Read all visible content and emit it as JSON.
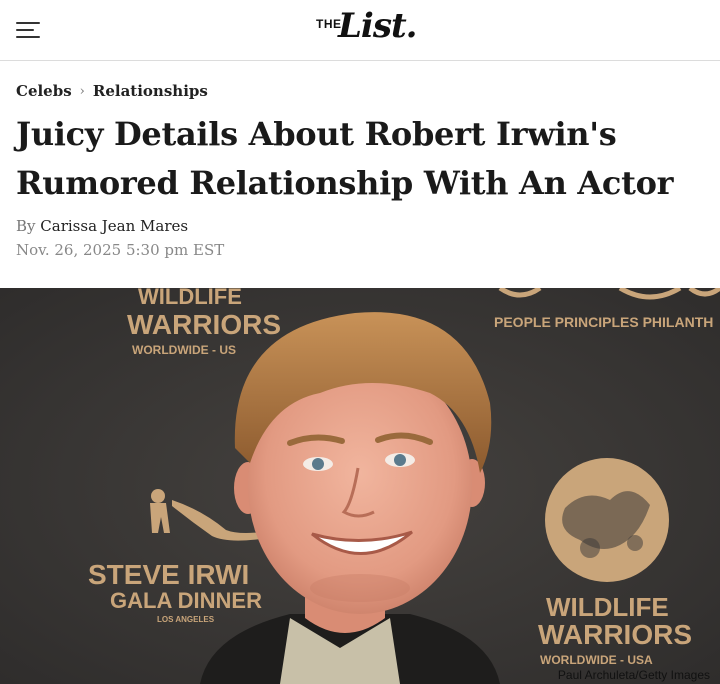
{
  "header": {
    "menu_icon": "hamburger-menu-icon",
    "logo_the": "THE",
    "logo_list": "List."
  },
  "breadcrumb": {
    "items": [
      "Celebs",
      "Relationships"
    ],
    "separator": "›"
  },
  "article": {
    "title": "Juicy Details About Robert Irwin's Rumored Relationship With An Actor",
    "by_label": "By",
    "author": "Carissa Jean Mares",
    "date": "Nov. 26, 2025 5:30 pm EST"
  },
  "hero": {
    "backdrop_text": {
      "wildlife_top_1": "WILDLIFE",
      "wildlife_top_2": "WARRIORS",
      "worldwide_top": "WORLDWIDE - US",
      "people_principles": "PEOPLE PRINCIPLES PHILANTH",
      "steve_irwin": "STEVE IRWI",
      "gala_dinner": "GALA DINNER",
      "los_angeles": "LOS ANGELES",
      "wildlife_bottom_1": "WILDLIFE",
      "wildlife_bottom_2": "WARRIORS",
      "worldwide_bottom": "WORLDWIDE - USA"
    },
    "credit": "Paul Archuleta/Getty Images"
  },
  "colors": {
    "backdrop": "#3a3837",
    "logo_gold": "#c9a57a",
    "text": "#1a1a1a"
  }
}
